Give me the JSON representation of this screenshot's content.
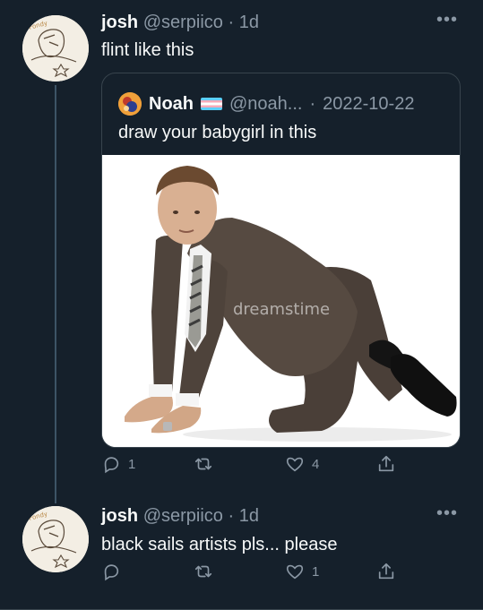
{
  "colors": {
    "background": "#15202b",
    "text": "#f7f9f9",
    "secondary": "#8b98a5",
    "border": "#38444d"
  },
  "tweets": [
    {
      "name": "josh",
      "handle": "@serpiico",
      "separator": "·",
      "time": "1d",
      "text": "flint like this",
      "more_icon": "•••",
      "quote": {
        "name": "Noah",
        "handle": "@noah...",
        "separator": "·",
        "date": "2022-10-22",
        "text": "draw your babygirl in this",
        "watermark": "dreamstime"
      },
      "actions": {
        "replies": "1",
        "retweets": "",
        "likes": "4"
      }
    },
    {
      "name": "josh",
      "handle": "@serpiico",
      "separator": "·",
      "time": "1d",
      "text": "black sails artists pls... please",
      "more_icon": "•••",
      "actions": {
        "replies": "",
        "retweets": "",
        "likes": "1"
      }
    }
  ]
}
